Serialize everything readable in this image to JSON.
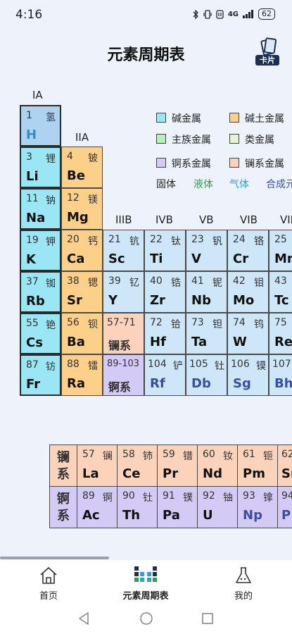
{
  "status_bar": {
    "time": "4:16",
    "network": "4G",
    "battery": "62"
  },
  "header": {
    "title": "元素周期表",
    "card_label": "卡片"
  },
  "groups": {
    "g1": "IA",
    "g2": "IIA",
    "g3": "IIIB",
    "g4": "IVB",
    "g5": "VB",
    "g6": "VIB",
    "g7": "VII"
  },
  "legend": {
    "alkali": "碱金属",
    "alkaline_earth": "碱土金属",
    "main_group": "主族金属",
    "metalloid": "类金属",
    "actinide": "锕系金属",
    "lanthanide": "镧系金属",
    "states": {
      "solid": "固体",
      "liquid": "液体",
      "gas": "气体",
      "synthetic": "合成元"
    },
    "colors": {
      "solid": "#222222",
      "liquid": "#2aa04a",
      "gas": "#2f9fd6",
      "synthetic": "#3a4fa3"
    }
  },
  "elements": {
    "h": {
      "num": "1",
      "cn": "氢",
      "sym": "H"
    },
    "li": {
      "num": "3",
      "cn": "锂",
      "sym": "Li"
    },
    "be": {
      "num": "4",
      "cn": "铍",
      "sym": "Be"
    },
    "na": {
      "num": "11",
      "cn": "钠",
      "sym": "Na"
    },
    "mg": {
      "num": "12",
      "cn": "镁",
      "sym": "Mg"
    },
    "k": {
      "num": "19",
      "cn": "钾",
      "sym": "K"
    },
    "ca": {
      "num": "20",
      "cn": "钙",
      "sym": "Ca"
    },
    "sc": {
      "num": "21",
      "cn": "钪",
      "sym": "Sc"
    },
    "ti": {
      "num": "22",
      "cn": "钛",
      "sym": "Ti"
    },
    "v": {
      "num": "23",
      "cn": "钒",
      "sym": "V"
    },
    "cr": {
      "num": "24",
      "cn": "铬",
      "sym": "Cr"
    },
    "mn": {
      "num": "25",
      "cn": "",
      "sym": "Mn"
    },
    "rb": {
      "num": "37",
      "cn": "铷",
      "sym": "Rb"
    },
    "sr": {
      "num": "38",
      "cn": "锶",
      "sym": "Sr"
    },
    "y": {
      "num": "39",
      "cn": "钇",
      "sym": "Y"
    },
    "zr": {
      "num": "40",
      "cn": "锆",
      "sym": "Zr"
    },
    "nb": {
      "num": "41",
      "cn": "铌",
      "sym": "Nb"
    },
    "mo": {
      "num": "42",
      "cn": "钼",
      "sym": "Mo"
    },
    "tc": {
      "num": "43",
      "cn": "",
      "sym": "Tc"
    },
    "cs": {
      "num": "55",
      "cn": "铯",
      "sym": "Cs"
    },
    "ba": {
      "num": "56",
      "cn": "钡",
      "sym": "Ba"
    },
    "la_series": {
      "range": "57-71",
      "label": "镧系"
    },
    "hf": {
      "num": "72",
      "cn": "铪",
      "sym": "Hf"
    },
    "ta": {
      "num": "73",
      "cn": "钽",
      "sym": "Ta"
    },
    "w": {
      "num": "74",
      "cn": "钨",
      "sym": "W"
    },
    "re": {
      "num": "75",
      "cn": "",
      "sym": "Re"
    },
    "fr": {
      "num": "87",
      "cn": "钫",
      "sym": "Fr"
    },
    "ra": {
      "num": "88",
      "cn": "镭",
      "sym": "Ra"
    },
    "ac_series": {
      "range": "89-103",
      "label": "锕系"
    },
    "rf": {
      "num": "104",
      "cn": "铲",
      "sym": "Rf"
    },
    "db": {
      "num": "105",
      "cn": "钍",
      "sym": "Db"
    },
    "sg": {
      "num": "106",
      "cn": "镆",
      "sym": "Sg"
    },
    "bh": {
      "num": "107",
      "cn": "",
      "sym": "Bh"
    },
    "la": {
      "num": "57",
      "cn": "镧",
      "sym": "La"
    },
    "ce": {
      "num": "58",
      "cn": "铈",
      "sym": "Ce"
    },
    "pr": {
      "num": "59",
      "cn": "镨",
      "sym": "Pr"
    },
    "nd": {
      "num": "60",
      "cn": "钕",
      "sym": "Nd"
    },
    "pm": {
      "num": "61",
      "cn": "钷",
      "sym": "Pm"
    },
    "sm": {
      "num": "62",
      "cn": "",
      "sym": "Sm"
    },
    "ac": {
      "num": "89",
      "cn": "锕",
      "sym": "Ac"
    },
    "th": {
      "num": "90",
      "cn": "钍",
      "sym": "Th"
    },
    "pa": {
      "num": "91",
      "cn": "镤",
      "sym": "Pa"
    },
    "u": {
      "num": "92",
      "cn": "铀",
      "sym": "U"
    },
    "np": {
      "num": "93",
      "cn": "镎",
      "sym": "Np"
    },
    "pu": {
      "num": "94",
      "cn": "",
      "sym": "P"
    }
  },
  "series_labels": {
    "lan_a": "镧",
    "lan_b": "系",
    "act_a": "锕",
    "act_b": "系"
  },
  "nav": {
    "home": "首页",
    "table": "元素周期表",
    "mine": "我的"
  }
}
